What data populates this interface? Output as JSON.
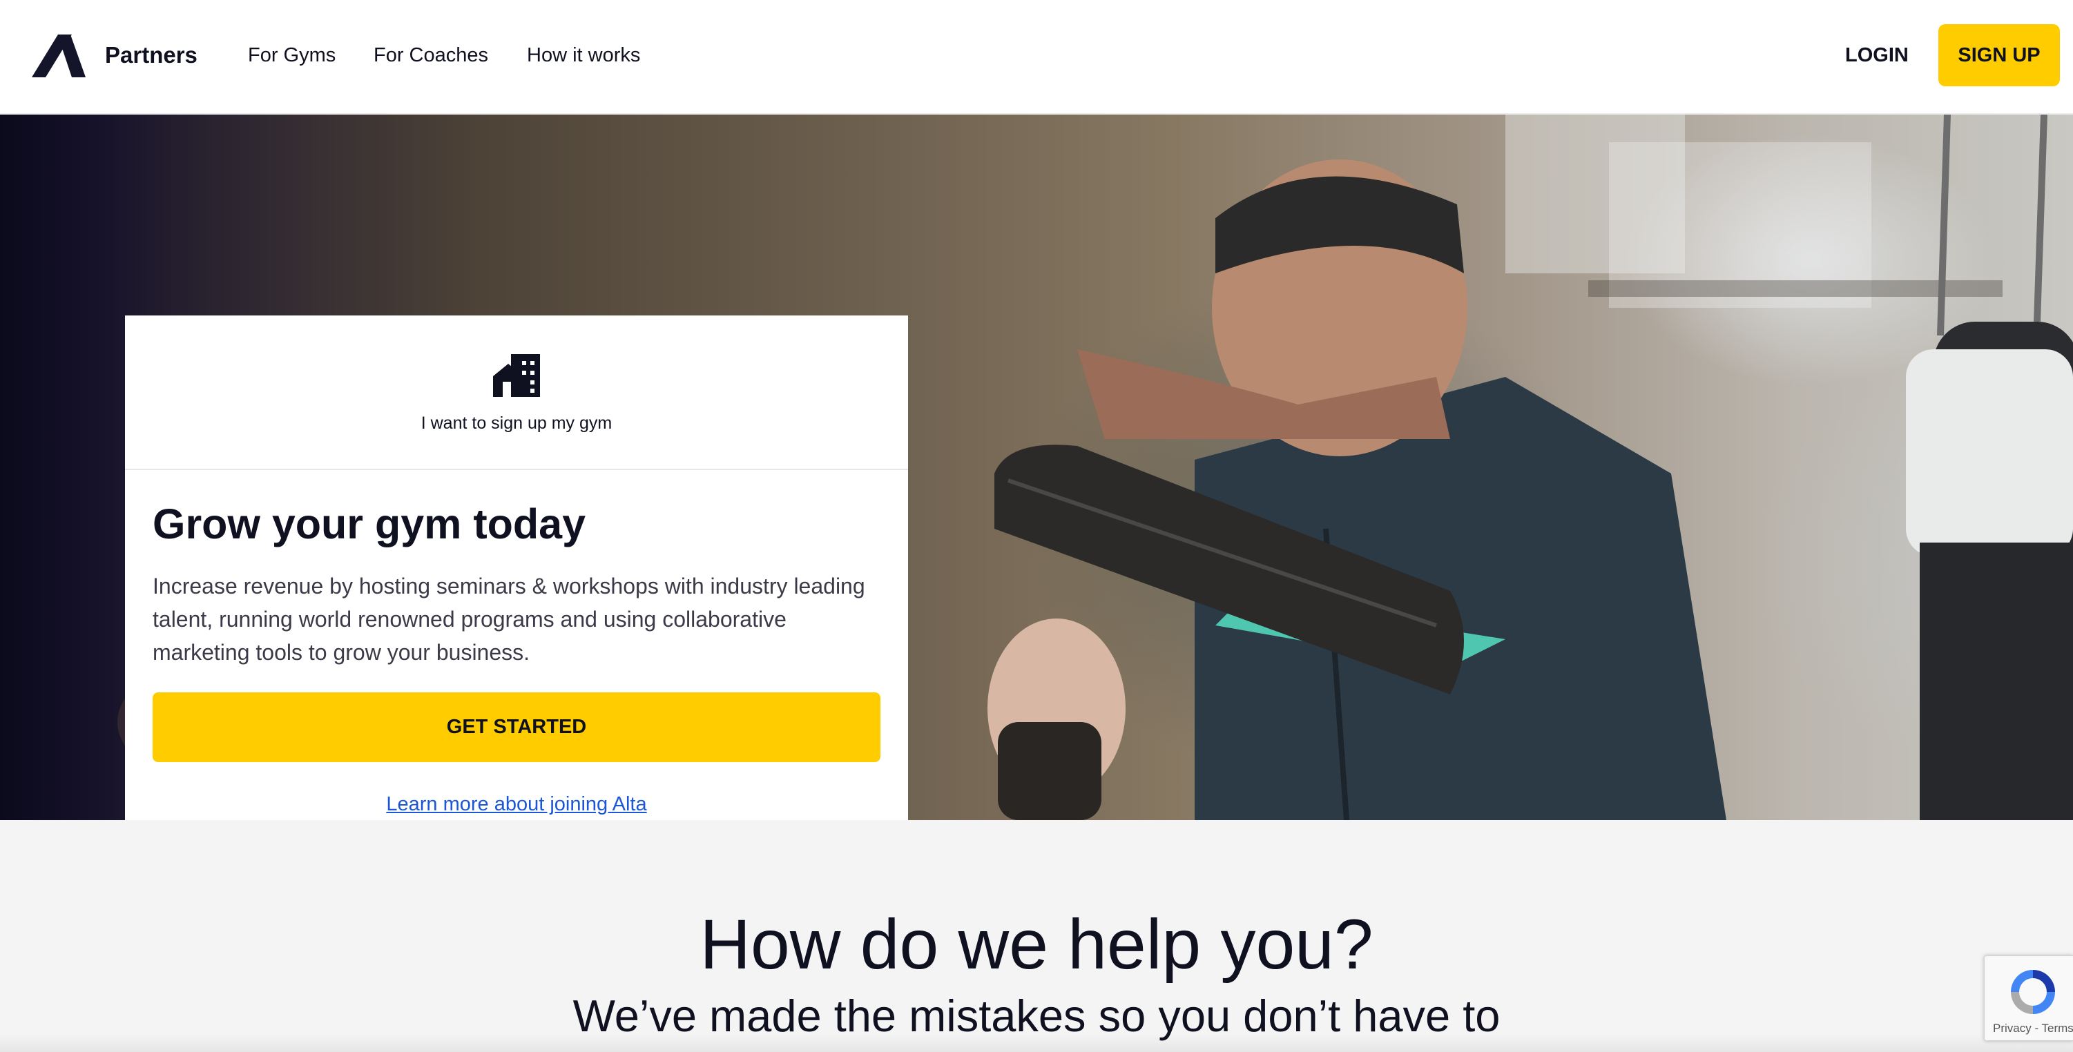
{
  "header": {
    "brand": "Partners",
    "nav": {
      "gyms": "For Gyms",
      "coaches": "For Coaches",
      "how": "How it works"
    },
    "login": "LOGIN",
    "signup": "SIGN UP"
  },
  "card": {
    "tag": "I want to sign up my gym",
    "title": "Grow your gym today",
    "description": "Increase revenue by hosting seminars & workshops with industry leading talent, running world renowned programs and using collaborative marketing tools to grow your business.",
    "cta": "GET STARTED",
    "learn_more": "Learn more about joining Alta"
  },
  "help": {
    "title": "How do we help you?",
    "subtitle": "We’ve made the mistakes so you don’t have to"
  },
  "recaptcha": {
    "links": "Privacy - Terms"
  },
  "icons": {
    "logo": "alta-logo-icon",
    "building": "building-icon",
    "recaptcha": "recaptcha-icon"
  },
  "colors": {
    "accent": "#ffcc00",
    "text": "#0f1020",
    "link": "#1a56d6",
    "section_bg": "#f4f4f4"
  }
}
